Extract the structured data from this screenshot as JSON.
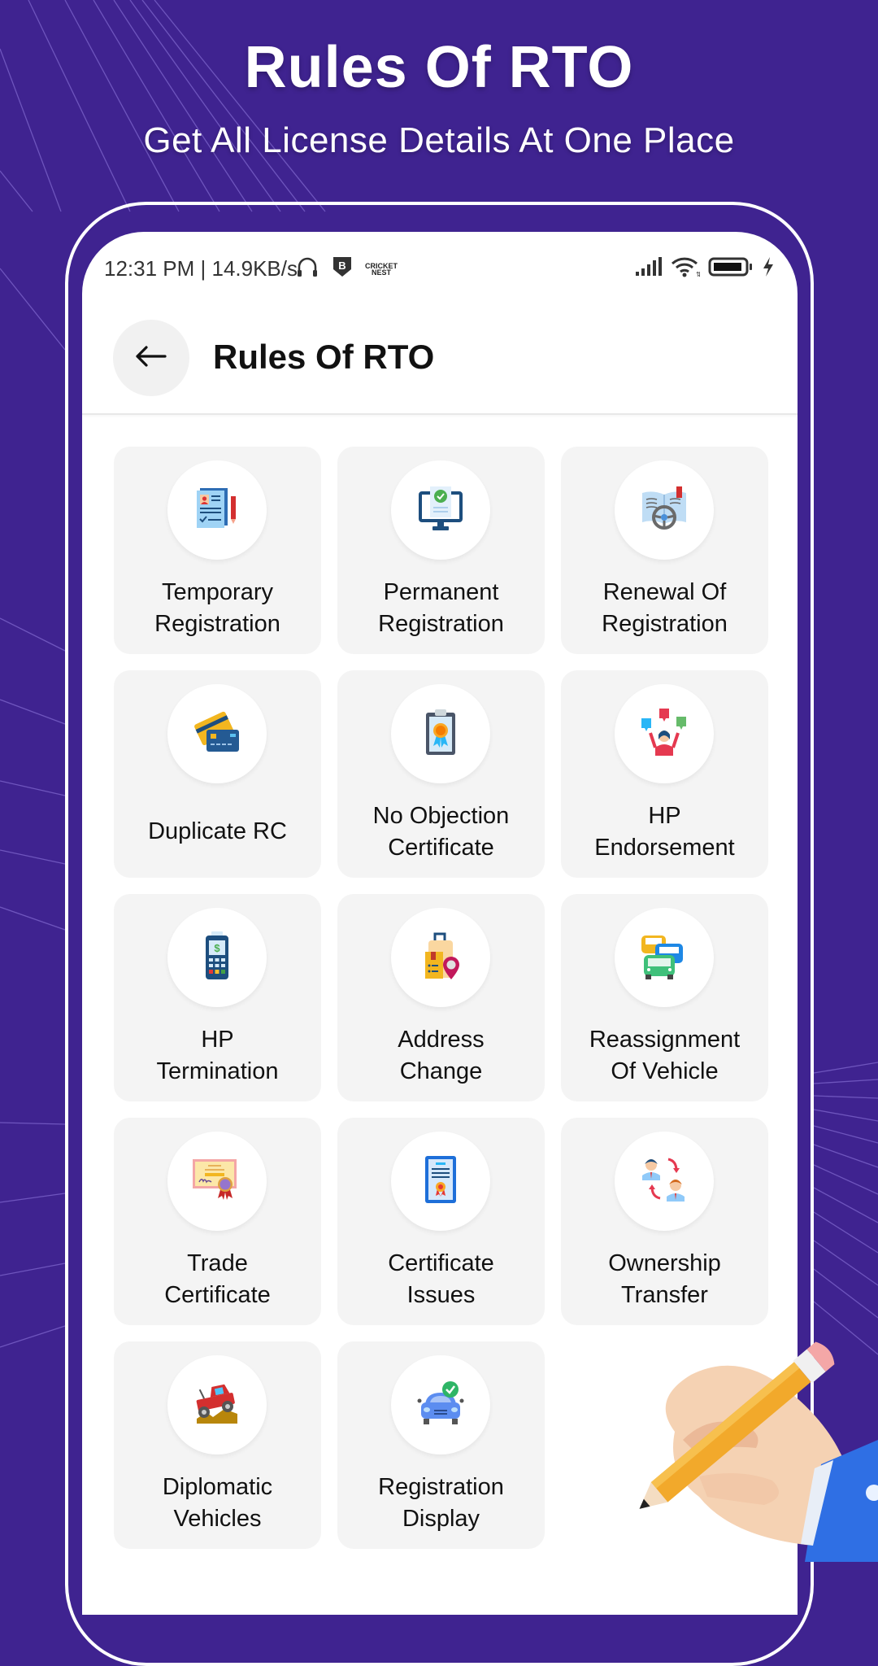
{
  "promo": {
    "title": "Rules Of RTO",
    "subtitle": "Get All License Details At One Place"
  },
  "status_bar": {
    "time_speed": "12:31 PM | 14.9KB/s",
    "left_icons": [
      "headphones-icon",
      "app-b-shield-icon",
      "cricket-nest-icon"
    ],
    "cricket_label_line1": "CRICKET",
    "cricket_label_line2": "NEST",
    "right_icons": [
      "signal-icon",
      "wifi-icon",
      "battery-icon",
      "charging-icon"
    ]
  },
  "app_bar": {
    "back_icon": "arrow-left-icon",
    "title": "Rules Of RTO"
  },
  "items": [
    {
      "label": "Temporary\nRegistration",
      "icon": "document-form-icon"
    },
    {
      "label": "Permanent\nRegistration",
      "icon": "monitor-check-icon"
    },
    {
      "label": "Renewal Of\nRegistration",
      "icon": "book-steering-icon"
    },
    {
      "label": "Duplicate RC",
      "icon": "cards-icon"
    },
    {
      "label": "No Objection\nCertificate",
      "icon": "clipboard-badge-icon"
    },
    {
      "label": "HP\nEndorsement",
      "icon": "person-feedback-icon"
    },
    {
      "label": "HP\nTermination",
      "icon": "payment-terminal-icon"
    },
    {
      "label": "Address\nChange",
      "icon": "luggage-location-icon"
    },
    {
      "label": "Reassignment\nOf Vehicle",
      "icon": "cars-icon"
    },
    {
      "label": "Trade\nCertificate",
      "icon": "certificate-ribbon-icon"
    },
    {
      "label": "Certificate\nIssues",
      "icon": "certificate-document-icon"
    },
    {
      "label": "Ownership\nTransfer",
      "icon": "people-exchange-icon"
    },
    {
      "label": "Diplomatic\nVehicles",
      "icon": "jeep-icon"
    },
    {
      "label": "Registration\nDisplay",
      "icon": "car-check-icon"
    }
  ],
  "colors": {
    "background": "#3F2390",
    "card": "#F4F4F4",
    "text": "#111111"
  }
}
